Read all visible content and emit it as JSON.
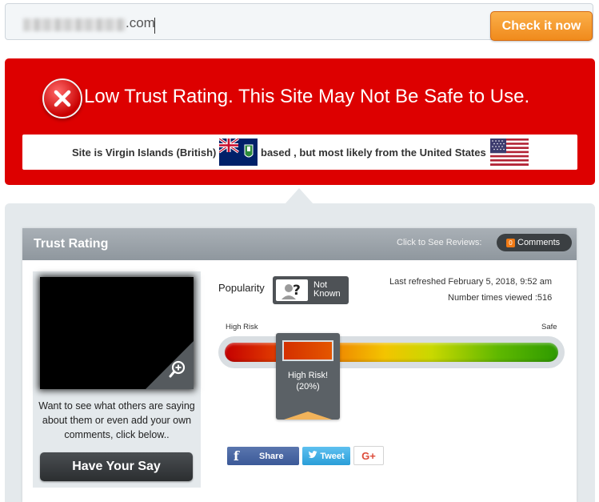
{
  "search": {
    "domain_suffix": ".com",
    "check_button": "Check it now"
  },
  "banner": {
    "title": "Low Trust Rating. This Site May Not Be Safe to Use.",
    "location_prefix": "Site is Virgin Islands (British)",
    "location_middle": "based , but most likely from the United States",
    "flags": [
      "british-virgin-islands-flag",
      "united-states-flag"
    ],
    "color": "#dd0000"
  },
  "panel": {
    "title": "Trust Rating",
    "reviews_label": "Click to See Reviews:",
    "comments_count": "0",
    "comments_label": "Comments"
  },
  "left": {
    "say_text": "Want to see what others are saying about them or even add your own comments, click below..",
    "say_button": "Have Your Say"
  },
  "popularity": {
    "label": "Popularity",
    "value_line1": "Not",
    "value_line2": "Known"
  },
  "stats": {
    "last_refreshed": "Last refreshed February 5, 2018, 9:52 am",
    "times_viewed": "Number times viewed :516"
  },
  "meter": {
    "label_left": "High Risk",
    "label_right": "Safe",
    "status": "High Risk!",
    "percent_label": "(20%)",
    "percent": 20
  },
  "social": {
    "share": "Share",
    "tweet": "Tweet",
    "gplus": "G+"
  }
}
